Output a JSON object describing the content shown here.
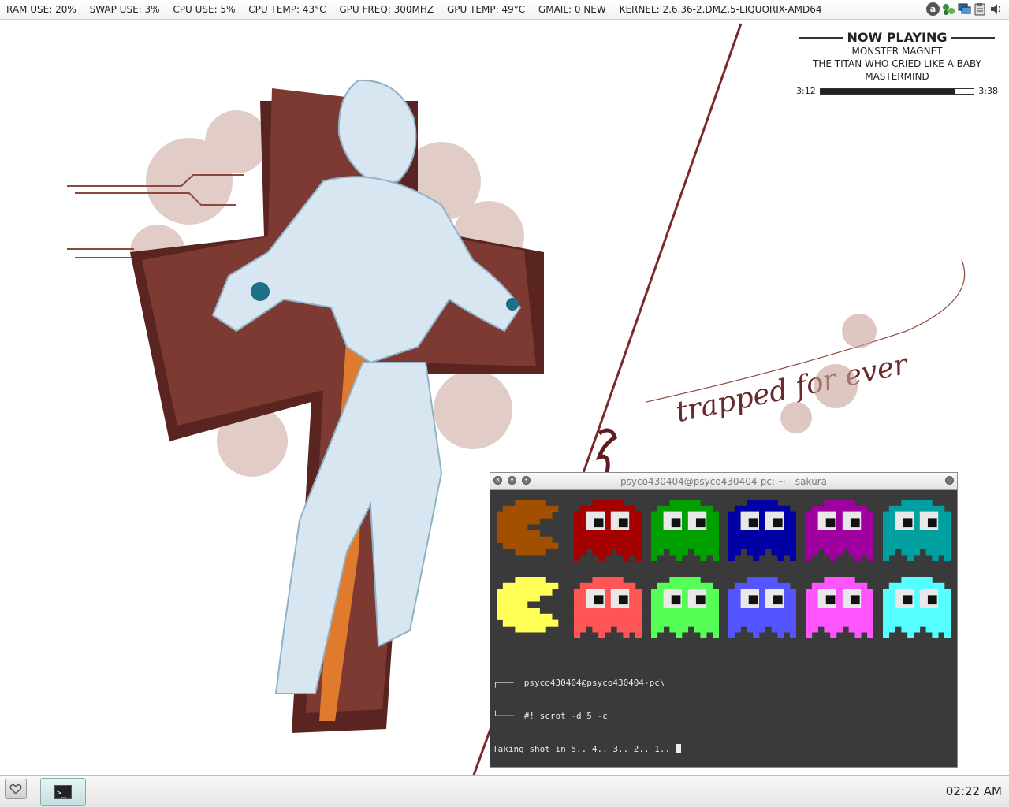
{
  "top_bar": {
    "stats": [
      "RAM USE: 20%",
      "SWAP USE: 3%",
      "CPU USE: 5%",
      "CPU TEMP: 43°C",
      "GPU FREQ: 300MHZ",
      "GPU TEMP: 49°C",
      "GMAIL: 0 NEW",
      "KERNEL: 2.6.36-2.DMZ.5-LIQUORIX-AMD64"
    ],
    "tray_icons": [
      "amarok-icon",
      "network-icon",
      "display-icon",
      "clipboard-icon",
      "volume-icon"
    ]
  },
  "now_playing": {
    "title": "NOW PLAYING",
    "artist": "MONSTER MAGNET",
    "track": "THE TITAN WHO CRIED LIKE A BABY",
    "album": "MASTERMIND",
    "elapsed": "3:12",
    "total": "3:38",
    "progress": 0.88
  },
  "wallpaper": {
    "text": "trapped for ever"
  },
  "terminal": {
    "title": "psyco430404@psyco430404-pc: ~ - sakura",
    "lines": [
      "┌───  psyco430404@psyco430404-pc\\",
      "└───  #! scrot -d 5 -c",
      "Taking shot in 5.. 4.. 3.. 2.. 1.. "
    ],
    "dim_row_colors": [
      "#a24f00",
      "#a40000",
      "#00a000",
      "#0000a4",
      "#a000a0",
      "#00a0a0"
    ],
    "bright_row_colors": [
      "#ffff55",
      "#ff5555",
      "#55ff55",
      "#5555ff",
      "#ff55ff",
      "#55ffff"
    ]
  },
  "panel": {
    "clock": "02:22 AM"
  }
}
